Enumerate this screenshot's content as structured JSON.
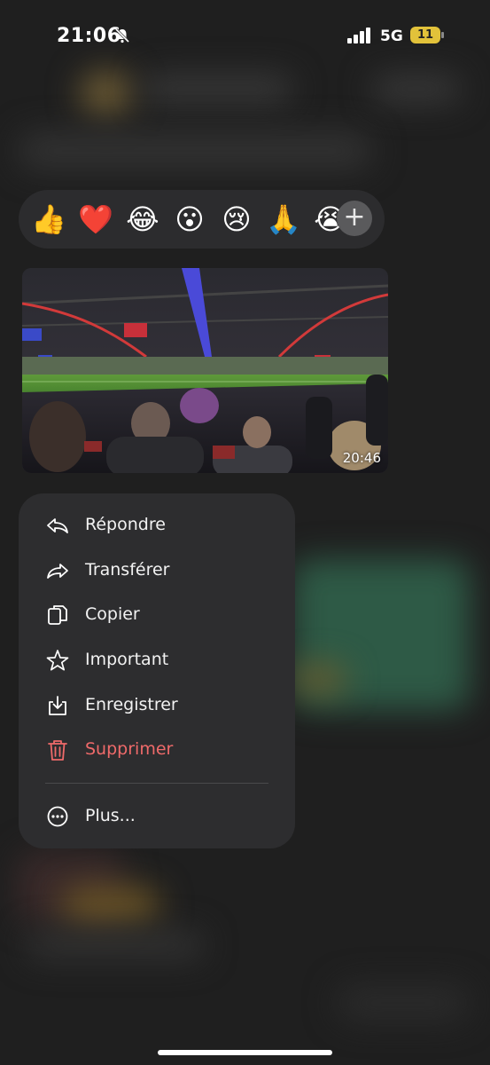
{
  "status_bar": {
    "time": "21:06",
    "network": "5G",
    "battery": "11",
    "battery_color": "#e2c23a"
  },
  "reactions": {
    "emojis": [
      "👍",
      "❤️",
      "😂",
      "😮",
      "😢",
      "🙏",
      "😭"
    ],
    "more_icon": "plus-icon"
  },
  "message": {
    "duration": "20:46"
  },
  "menu": {
    "items": [
      {
        "label": "Répondre",
        "icon": "reply-icon"
      },
      {
        "label": "Transférer",
        "icon": "forward-icon"
      },
      {
        "label": "Copier",
        "icon": "copy-icon"
      },
      {
        "label": "Important",
        "icon": "star-icon"
      },
      {
        "label": "Enregistrer",
        "icon": "download-icon"
      },
      {
        "label": "Supprimer",
        "icon": "trash-icon",
        "color": "#ef6a6a"
      },
      {
        "label": "Plus...",
        "icon": "more-icon"
      }
    ]
  }
}
